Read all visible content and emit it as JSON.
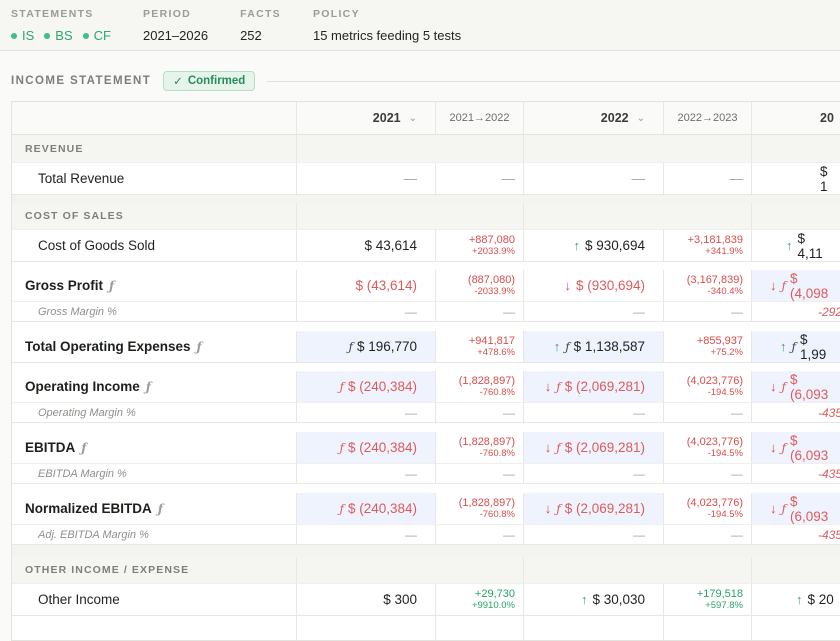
{
  "meta": {
    "statements_label": "STATEMENTS",
    "statements": [
      "IS",
      "BS",
      "CF"
    ],
    "period_label": "PERIOD",
    "period": "2021–2026",
    "facts_label": "FACTS",
    "facts": "252",
    "policy_label": "POLICY",
    "policy": "15 metrics feeding 5 tests"
  },
  "section": {
    "title": "INCOME STATEMENT",
    "badge": "Confirmed",
    "check": "✓"
  },
  "headers": {
    "y1": "2021",
    "d1": "2021→2022",
    "y2": "2022",
    "d2": "2022→2023",
    "y3": "20",
    "chev": "⌄"
  },
  "dash": "—",
  "fmark": "ƒ",
  "rows": {
    "revenue_hdr": "REVENUE",
    "total_revenue": {
      "label": "Total Revenue",
      "y3": "$ 1"
    },
    "cos_hdr": "COST OF SALES",
    "cogs": {
      "label": "Cost of Goods Sold",
      "y1": "$ 43,614",
      "d1a": "+887,080",
      "d1b": "+2033.9%",
      "y2": "$ 930,694",
      "d2a": "+3,181,839",
      "d2b": "+341.9%",
      "y3": "$ 4,11"
    },
    "gross": {
      "label": "Gross Profit",
      "y1": "$ (43,614)",
      "d1a": "(887,080)",
      "d1b": "-2033.9%",
      "y2": "$ (930,694)",
      "d2a": "(3,167,839)",
      "d2b": "-340.4%",
      "y3": "$ (4,098"
    },
    "gross_margin": {
      "label": "Gross Margin %",
      "y3": "-292"
    },
    "opex": {
      "label": "Total Operating Expenses",
      "y1": "$ 196,770",
      "d1a": "+941,817",
      "d1b": "+478.6%",
      "y2": "$ 1,138,587",
      "d2a": "+855,937",
      "d2b": "+75.2%",
      "y3": "$ 1,99"
    },
    "opinc": {
      "label": "Operating Income",
      "y1": "$ (240,384)",
      "d1a": "(1,828,897)",
      "d1b": "-760.8%",
      "y2": "$ (2,069,281)",
      "d2a": "(4,023,776)",
      "d2b": "-194.5%",
      "y3": "$ (6,093"
    },
    "op_margin": {
      "label": "Operating Margin %",
      "y3": "-435"
    },
    "ebitda": {
      "label": "EBITDA",
      "y1": "$ (240,384)",
      "d1a": "(1,828,897)",
      "d1b": "-760.8%",
      "y2": "$ (2,069,281)",
      "d2a": "(4,023,776)",
      "d2b": "-194.5%",
      "y3": "$ (6,093"
    },
    "ebitda_margin": {
      "label": "EBITDA Margin %",
      "y3": "-435"
    },
    "nebitda": {
      "label": "Normalized EBITDA",
      "y1": "$ (240,384)",
      "d1a": "(1,828,897)",
      "d1b": "-760.8%",
      "y2": "$ (2,069,281)",
      "d2a": "(4,023,776)",
      "d2b": "-194.5%",
      "y3": "$ (6,093"
    },
    "adj_margin": {
      "label": "Adj. EBITDA Margin %",
      "y3": "-435"
    },
    "oie_hdr": "OTHER INCOME / EXPENSE",
    "other_income": {
      "label": "Other Income",
      "y1": "$ 300",
      "d1a": "+29,730",
      "d1b": "+9910.0%",
      "y2": "$ 30,030",
      "d2a": "+179,518",
      "d2b": "+597.8%",
      "y3": "$ 20"
    }
  },
  "colors": {
    "accent_green": "#2aa86f",
    "negative": "#df5b5b",
    "highlight": "#eef3fd"
  }
}
